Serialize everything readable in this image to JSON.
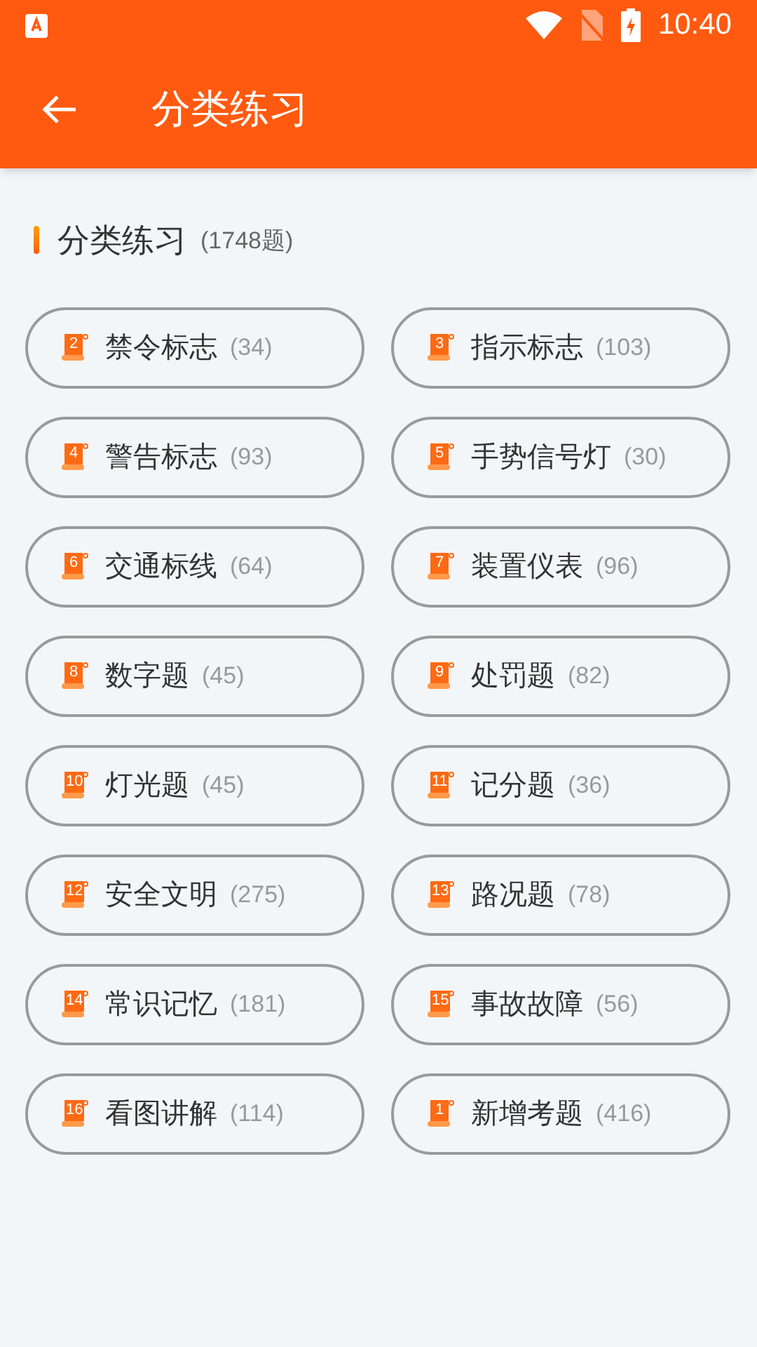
{
  "status_bar": {
    "time": "10:40"
  },
  "app_bar": {
    "title": "分类练习"
  },
  "section": {
    "title": "分类练习",
    "count": "(1748题)"
  },
  "categories": [
    {
      "number": "2",
      "label": "禁令标志",
      "count": "(34)"
    },
    {
      "number": "3",
      "label": "指示标志",
      "count": "(103)"
    },
    {
      "number": "4",
      "label": "警告标志",
      "count": "(93)"
    },
    {
      "number": "5",
      "label": "手势信号灯",
      "count": "(30)"
    },
    {
      "number": "6",
      "label": "交通标线",
      "count": "(64)"
    },
    {
      "number": "7",
      "label": "装置仪表",
      "count": "(96)"
    },
    {
      "number": "8",
      "label": "数字题",
      "count": "(45)"
    },
    {
      "number": "9",
      "label": "处罚题",
      "count": "(82)"
    },
    {
      "number": "10",
      "label": "灯光题",
      "count": "(45)"
    },
    {
      "number": "11",
      "label": "记分题",
      "count": "(36)"
    },
    {
      "number": "12",
      "label": "安全文明",
      "count": "(275)"
    },
    {
      "number": "13",
      "label": "路况题",
      "count": "(78)"
    },
    {
      "number": "14",
      "label": "常识记忆",
      "count": "(181)"
    },
    {
      "number": "15",
      "label": "事故故障",
      "count": "(56)"
    },
    {
      "number": "16",
      "label": "看图讲解",
      "count": "(114)"
    },
    {
      "number": "1",
      "label": "新增考题",
      "count": "(416)"
    }
  ]
}
